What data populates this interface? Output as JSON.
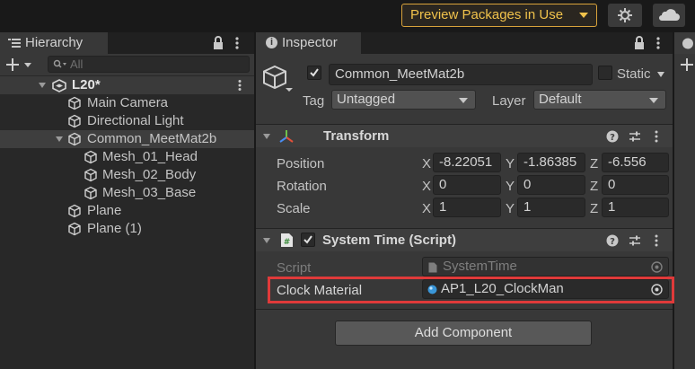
{
  "toolbar": {
    "preview_packages_label": "Preview Packages in Use",
    "settings_icon": "gear-icon",
    "cloud_icon": "cloud-icon"
  },
  "hierarchy": {
    "tab_label": "Hierarchy",
    "search_placeholder": "All",
    "scene": {
      "label": "L20*"
    },
    "items": [
      {
        "label": "Main Camera"
      },
      {
        "label": "Directional Light"
      },
      {
        "label": "Common_MeetMat2b"
      },
      {
        "label": "Mesh_01_Head"
      },
      {
        "label": "Mesh_02_Body"
      },
      {
        "label": "Mesh_03_Base"
      },
      {
        "label": "Plane"
      },
      {
        "label": "Plane (1)"
      }
    ]
  },
  "inspector": {
    "tab_label": "Inspector",
    "object": {
      "name": "Common_MeetMat2b",
      "active": true,
      "static_label": "Static",
      "tag_label": "Tag",
      "tag_value": "Untagged",
      "layer_label": "Layer",
      "layer_value": "Default"
    },
    "transform": {
      "title": "Transform",
      "rows": [
        {
          "label": "Position",
          "x": "-8.22051",
          "y": "-1.86385",
          "z": "-6.556"
        },
        {
          "label": "Rotation",
          "x": "0",
          "y": "0",
          "z": "0"
        },
        {
          "label": "Scale",
          "x": "1",
          "y": "1",
          "z": "1"
        }
      ],
      "axes": {
        "x": "X",
        "y": "Y",
        "z": "Z"
      }
    },
    "system_time": {
      "title": "System Time (Script)",
      "enabled": true,
      "script_label": "Script",
      "script_value": "SystemTime",
      "clock_material_label": "Clock Material",
      "clock_material_value": "AP1_L20_ClockMan"
    },
    "add_component_label": "Add Component"
  },
  "colors": {
    "highlight": "#e03a3a",
    "preview_accent": "#f0c24b"
  }
}
